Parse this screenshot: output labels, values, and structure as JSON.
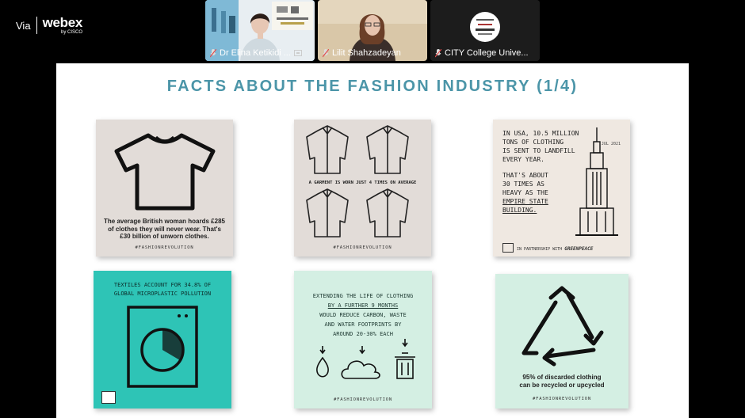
{
  "app": {
    "via": "Via",
    "name": "webex",
    "by": "by CISCO"
  },
  "participants": [
    {
      "name": "Dr Elina Ketikidi ...",
      "active": true
    },
    {
      "name": "Lilit Shahzadeyan",
      "active": false
    },
    {
      "name": "CITY College Unive...",
      "active": false
    }
  ],
  "slide": {
    "title": "FACTS ABOUT THE FASHION INDUSTRY (1/4)",
    "cards": {
      "c1": {
        "caption": "The average British woman hoards £285 of clothes they will never wear. That's £30 billion of unworn clothes.",
        "tag": "#FASHIONREVOLUTION"
      },
      "c2": {
        "caption": "A GARMENT IS WORN JUST 4 TIMES ON AVERAGE",
        "tag": "#FASHIONREVOLUTION"
      },
      "c3": {
        "date": "JUL 2021",
        "line1": "IN USA, 10.5 MILLION",
        "line2": "TONS OF CLOTHING",
        "line3": "IS SENT TO LANDFILL",
        "line4": "EVERY YEAR.",
        "line5": "THAT'S ABOUT",
        "line6": "30 TIMES AS",
        "line7": "HEAVY AS THE",
        "line8": "EMPIRE STATE",
        "line9": "BUILDING.",
        "partner": "IN PARTNERSHIP WITH",
        "brand": "GREENPEACE"
      },
      "c4": {
        "line1": "TEXTILES ACCOUNT FOR 34.8% OF",
        "line2": "GLOBAL MICROPLASTIC POLLUTION"
      },
      "c5": {
        "line1": "EXTENDING THE LIFE OF CLOTHING",
        "line2": "BY A FURTHER 9 MONTHS",
        "line3": "WOULD REDUCE CARBON, WASTE",
        "line4": "AND WATER FOOTPRINTS BY",
        "line5": "AROUND 20-30% EACH",
        "tag": "#FASHIONREVOLUTION"
      },
      "c6": {
        "caption": "95% of discarded clothing can be recycled or upcycled",
        "tag": "#FASHIONREVOLUTION"
      }
    }
  },
  "colors": {
    "title": "#4b95a8",
    "teal": "#2ec4b6",
    "mint": "#d4efe3",
    "beige": "#e2dcd8",
    "active_border": "#4aa8e8"
  }
}
